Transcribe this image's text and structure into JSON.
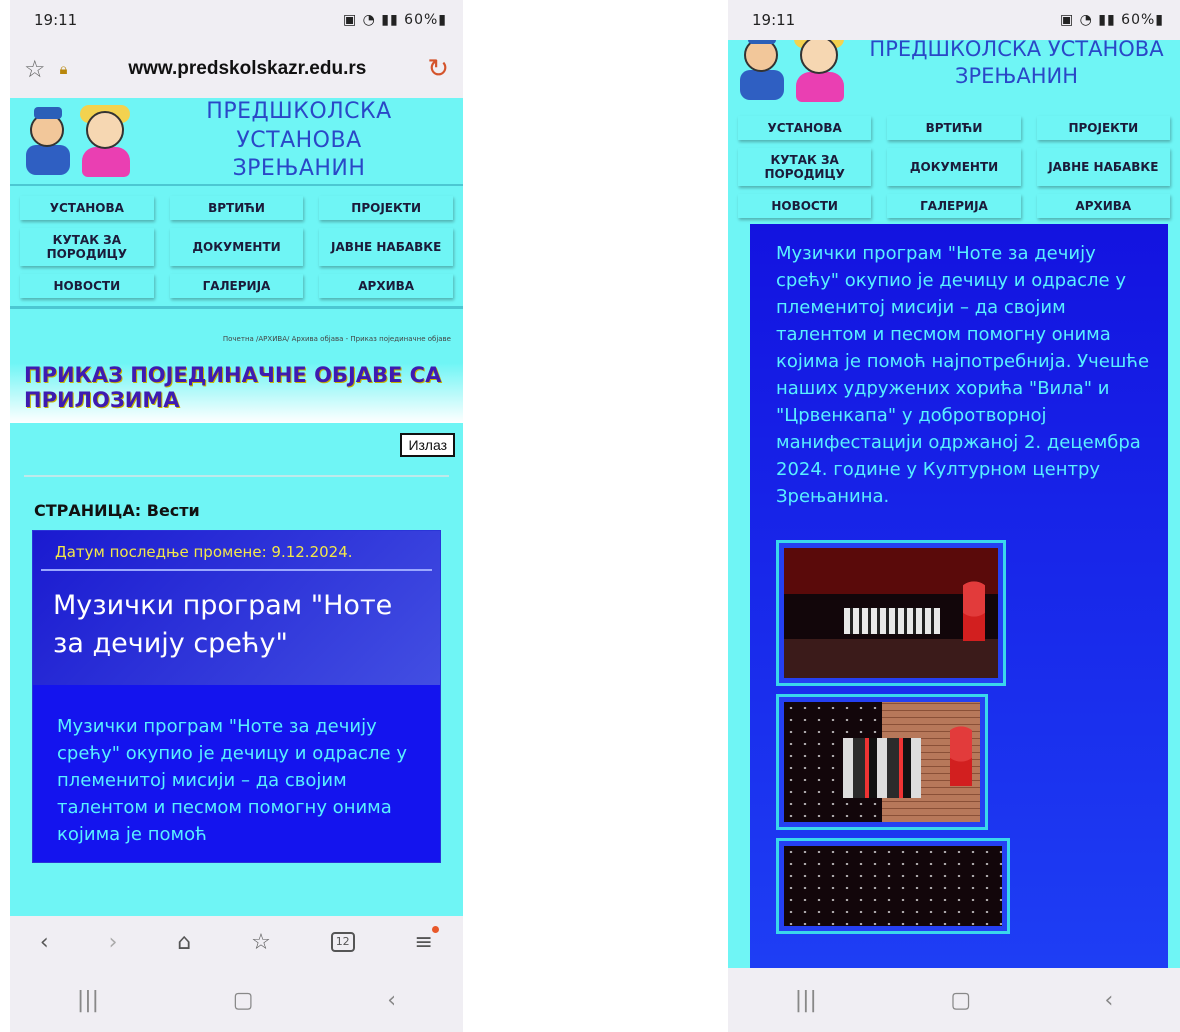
{
  "status": {
    "time": "19:11",
    "battery": "60%"
  },
  "browser": {
    "url": "www.predskolskazr.edu.rs",
    "tabs_count": "12"
  },
  "site": {
    "title_line1": "ПРЕДШКОЛСКА УСТАНОВА",
    "title_line2": "ЗРЕЊАНИН",
    "nav": [
      "УСТАНОВА",
      "ВРТИЋИ",
      "ПРОЈЕКТИ",
      "КУТАК ЗА ПОРОДИЦУ",
      "ДОКУМЕНТИ",
      "ЈАВНЕ НАБАВКЕ",
      "НОВОСТИ",
      "ГАЛЕРИЈА",
      "АРХИВА"
    ]
  },
  "page": {
    "breadcrumb": "Почетна /АРХИВА/ Архива објава - Приказ појединачне објаве",
    "heading": "ПРИКАЗ ПОЈЕДИНАЧНЕ ОБЈАВЕ СА ПРИЛОЗИМА",
    "exit_label": "Излаз",
    "section_label": "СТРАНИЦА: Вести"
  },
  "post": {
    "date": "Датум последње промене: 9.12.2024.",
    "title": "Музички програм \"Ноте за дечију срећу\"",
    "body_preview": "Музички програм \"Ноте за дечију срећу\" окупио је дечицу и одрасле у племенитој мисији – да својим талентом и песмом помогну онима којима је помоћ",
    "body": "Музички програм \"Ноте за дечију срећу\" окупио је дечицу и одрасле у племенитој мисији – да својим талентом и песмом помогну онима којима је помоћ најпотребнија. Учешће наших удружених хорића \"Вила\" и \"Црвенкапа\" у добротворној манифестацији одржаној 2. децембра 2024. године у Културном центру Зрењанина."
  },
  "colors": {
    "site_bg": "#6ff5f5",
    "post_bg": "#1414ee",
    "post_text": "#59f0ff",
    "date_text": "#f3e84a",
    "title_blue": "#2a47c7"
  },
  "icons": {
    "favorite": "star-outline-icon",
    "lock": "lock-icon",
    "reload": "reload-icon",
    "back": "back-icon",
    "forward": "forward-icon",
    "home": "home-icon",
    "bookmarks": "bookmarks-icon",
    "tabs": "tabs-icon",
    "menu": "menu-icon",
    "recents": "recents-icon",
    "home_button": "home-button-icon",
    "system_back": "system-back-icon"
  }
}
